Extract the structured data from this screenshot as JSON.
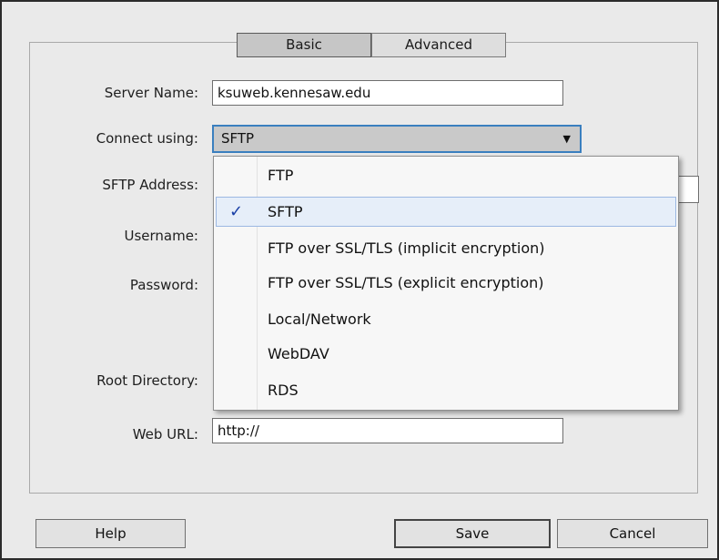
{
  "tabs": [
    {
      "label": "Basic",
      "active": true
    },
    {
      "label": "Advanced",
      "active": false
    }
  ],
  "fields": {
    "server_name": {
      "label": "Server Name:",
      "value": "ksuweb.kennesaw.edu"
    },
    "connect_using": {
      "label": "Connect using:",
      "value": "SFTP"
    },
    "sftp_address": {
      "label": "SFTP Address:"
    },
    "username": {
      "label": "Username:"
    },
    "password": {
      "label": "Password:"
    },
    "root_directory": {
      "label": "Root Directory:"
    },
    "web_url": {
      "label": "Web URL:",
      "value": "http://"
    }
  },
  "dropdown": {
    "selected": "SFTP",
    "check_glyph": "✓",
    "options": [
      "FTP",
      "SFTP",
      "FTP over SSL/TLS (implicit encryption)",
      "FTP over SSL/TLS (explicit encryption)",
      "Local/Network",
      "WebDAV",
      "RDS"
    ]
  },
  "buttons": {
    "help": "Help",
    "save": "Save",
    "cancel": "Cancel"
  },
  "icons": {
    "dropdown_arrow": "chevron-down-icon",
    "check": "checkmark-icon"
  },
  "colors": {
    "focus_border": "#3a7fbf",
    "selected_option_bg": "#e6eef9",
    "check": "#1a3fa6"
  }
}
